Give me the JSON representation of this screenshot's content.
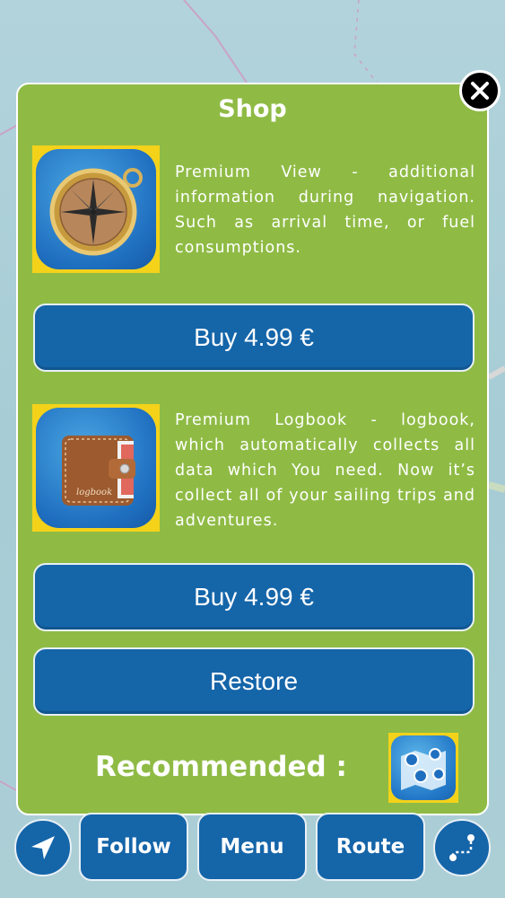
{
  "shop": {
    "title": "Shop",
    "close_icon": "close-icon",
    "products": [
      {
        "icon": "compass-icon",
        "description": "Premium View - additional information during navigation. Such as arrival time, or fuel consumptions.",
        "buy_label": "Buy 4.99 €"
      },
      {
        "icon": "logbook-wallet-icon",
        "description": "Premium Logbook - logbook, which automatically collects all data which You need. Now it’s collect all of your sailing trips and adventures.",
        "buy_label": "Buy 4.99 €"
      }
    ],
    "restore_label": "Restore",
    "recommended_label": "Recommended :",
    "recommended_app_icon": "map-app-icon"
  },
  "bottom_bar": {
    "locate_icon": "location-arrow-icon",
    "follow_label": "Follow",
    "menu_label": "Menu",
    "route_label": "Route",
    "route_icon": "route-path-icon"
  },
  "colors": {
    "panel_green": "#8fbb45",
    "button_blue": "#1565a9",
    "icon_gold": "#f4d21a",
    "map_water": "#a9ccd4"
  }
}
